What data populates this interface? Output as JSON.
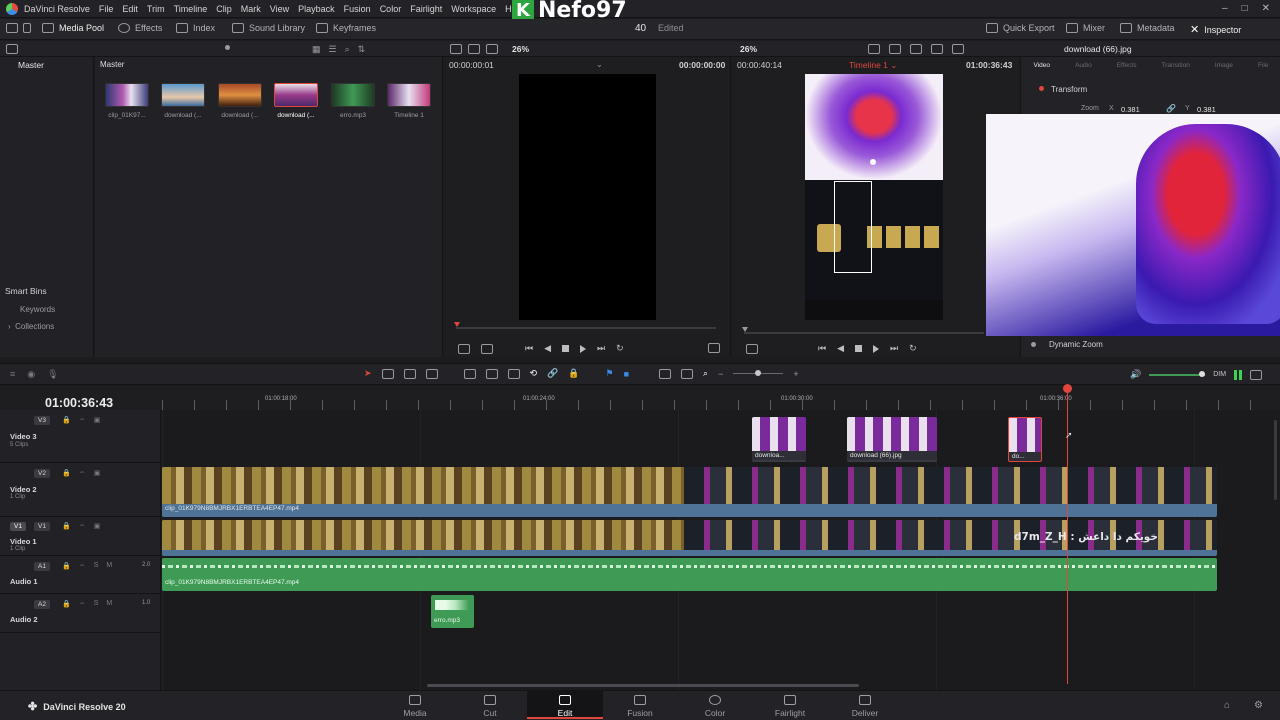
{
  "menubar": {
    "app_name": "DaVinci Resolve",
    "items": [
      "File",
      "Edit",
      "Trim",
      "Timeline",
      "Clip",
      "Mark",
      "View",
      "Playback",
      "Fusion",
      "Color",
      "Fairlight",
      "Workspace",
      "Help"
    ],
    "watermark_letter": "K",
    "watermark_name": "Nefo97"
  },
  "toolbar": {
    "media_pool": "Media Pool",
    "effects": "Effects",
    "index": "Index",
    "sound_library": "Sound Library",
    "keyframes": "Keyframes",
    "project_counter": "40",
    "project_status": "Edited",
    "quick_export": "Quick Export",
    "mixer": "Mixer",
    "metadata": "Metadata",
    "inspector": "Inspector"
  },
  "viewer_bar": {
    "src_zoom": "26%",
    "tl_zoom": "26%",
    "inspector_title": "download (66).jpg"
  },
  "bins": {
    "header": "Master",
    "smart_bins": "Smart Bins",
    "keywords": "Keywords",
    "collections": "Collections"
  },
  "media_pool": {
    "header": "Master",
    "clips": [
      {
        "label": "clip_01K97...",
        "color": "#3a3f7a"
      },
      {
        "label": "download (...",
        "color": "#4a86b8"
      },
      {
        "label": "download (...",
        "color": "#b85a2a"
      },
      {
        "label": "download (...",
        "color": "#8a3a4a"
      },
      {
        "label": "erro.mp3",
        "color": "#2e6a3a"
      },
      {
        "label": "Timeline 1",
        "color": "#5a2a6a"
      }
    ]
  },
  "source_viewer": {
    "timecode_left": "00:00:00:01",
    "timecode_right": "00:00:00:00"
  },
  "timeline_viewer": {
    "duration": "00:00:40:14",
    "timeline_name": "Timeline 1",
    "timecode": "01:00:36:43"
  },
  "inspector": {
    "tabs": [
      "Video",
      "Audio",
      "Effects",
      "Transition",
      "Image",
      "File"
    ],
    "section_transform": "Transform",
    "zoom_label": "Zoom",
    "zoom_x_label": "X",
    "zoom_x": "0.381",
    "zoom_y_label": "Y",
    "zoom_y": "0.381",
    "dynamic_zoom": "Dynamic Zoom"
  },
  "timeline": {
    "current_timecode": "01:00:36:43",
    "ruler": [
      "01:00:18:00",
      "01:00:24:00",
      "01:00:30:00",
      "01:00:36:00"
    ],
    "volume_label": "DIM",
    "tracks": [
      {
        "badge": "V3",
        "name": "Video 3",
        "sub": "5 Clips"
      },
      {
        "badge": "V2",
        "name": "Video 2",
        "sub": "1 Clip"
      },
      {
        "badge": "V1",
        "name": "Video 1",
        "sub": "1 Clip"
      },
      {
        "badge": "A1",
        "name": "Audio 1",
        "sub": "2.0"
      },
      {
        "badge": "A2",
        "name": "Audio 2",
        "sub": "1.0"
      }
    ],
    "v3_clips": [
      "downloa...",
      "download (66).jpg",
      "do..."
    ],
    "v2_clip_name": "clip_01K979N8BMJRBX1ERBTEA4EP47.mp4",
    "a1_clip_name": "clip_01K979N8BMJRBX1ERBTEA4EP47.mp4",
    "a2_clip_name": "erro.mp3",
    "subtitle_overlay": "d7m_Z_H : خويكم دا داعش"
  },
  "footer": {
    "app_version": "DaVinci Resolve 20",
    "pages": [
      "Media",
      "Cut",
      "Edit",
      "Fusion",
      "Color",
      "Fairlight",
      "Deliver"
    ],
    "active_page": "Edit"
  },
  "colors": {
    "playhead": "#e0463c",
    "audio_green": "#3f9a55",
    "video_blue": "#4f7396"
  }
}
